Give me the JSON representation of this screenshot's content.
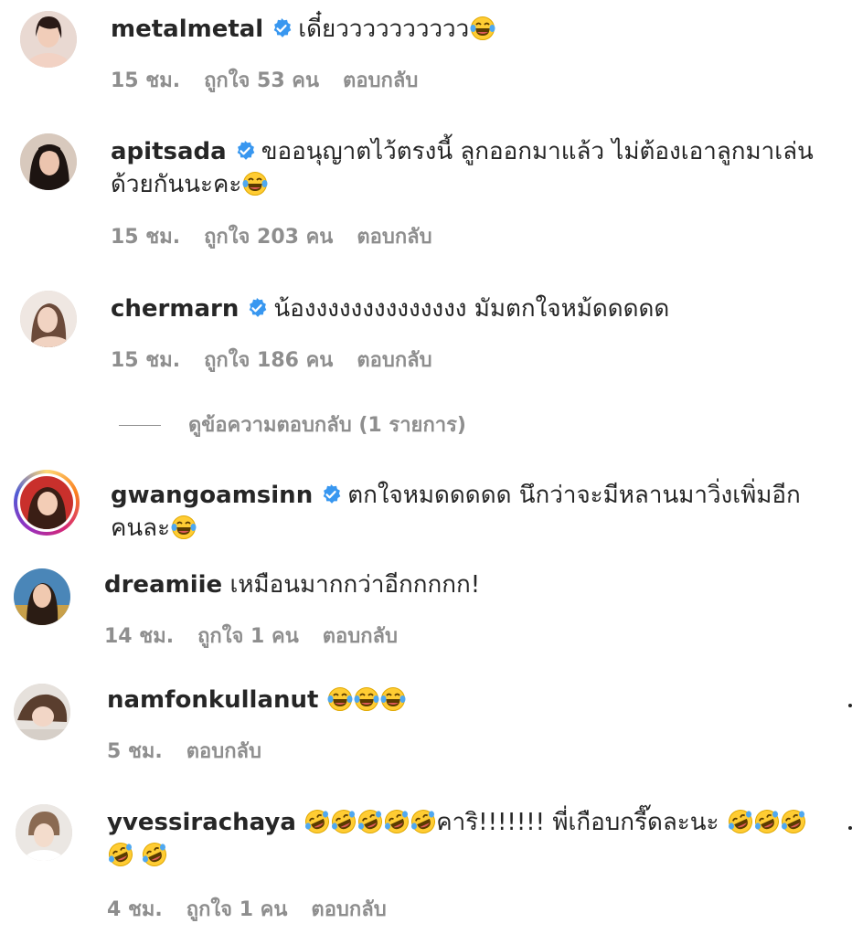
{
  "colors": {
    "verified": "#3897f0",
    "meta": "#8e8e8e",
    "text": "#262626"
  },
  "comments": [
    {
      "username": "metalmetal",
      "verified": true,
      "text": "เดี๋ยวววววววววว",
      "emoji": [
        "laugh-tears"
      ],
      "time": "15 ชม.",
      "likes": "ถูกใจ 53 คน",
      "reply": "ตอบกลับ"
    },
    {
      "username": "apitsada",
      "verified": true,
      "text": "ขออนุญาตไว้ตรงนี้ ลูกออกมาแล้ว ไม่ต้องเอาลูกมาเล่นด้วยกันนะคะ",
      "emoji": [
        "laugh-tears"
      ],
      "time": "15 ชม.",
      "likes": "ถูกใจ 203 คน",
      "reply": "ตอบกลับ"
    },
    {
      "username": "chermarn",
      "verified": true,
      "text": "น้องงงงงงงงงงงงงง มัมตกใจหม้ดดดดด",
      "emoji": [],
      "time": "15 ชม.",
      "likes": "ถูกใจ 186 คน",
      "reply": "ตอบกลับ"
    },
    {
      "username": "gwangoamsinn",
      "verified": true,
      "text": "ตกใจหมดดดดด นึกว่าจะมีหลานมาวิ่งเพิ่มอีกคนละ",
      "emoji": [
        "laugh-tears"
      ],
      "time": "",
      "likes": "",
      "reply": ""
    },
    {
      "username": "dreamiie",
      "verified": false,
      "text": "เหมือนมากกว่าอีกกกกก!",
      "emoji": [],
      "time": "14 ชม.",
      "likes": "ถูกใจ 1 คน",
      "reply": "ตอบกลับ"
    },
    {
      "username": "namfonkullanut",
      "verified": false,
      "text": "",
      "emoji": [
        "laugh-tears",
        "laugh-tears",
        "laugh-tears"
      ],
      "time": "5 ชม.",
      "likes": "",
      "reply": "ตอบกลับ"
    },
    {
      "username": "yvessirachaya",
      "verified": false,
      "text": "คาริ!!!!!!! พี่เกือบกรี๊ดละนะ",
      "emoji": [
        "rofl"
      ],
      "time": "4 ชม.",
      "likes": "ถูกใจ 1 คน",
      "reply": "ตอบกลับ"
    }
  ],
  "view_replies": "ดูข้อความตอบกลับ (1 รายการ)"
}
